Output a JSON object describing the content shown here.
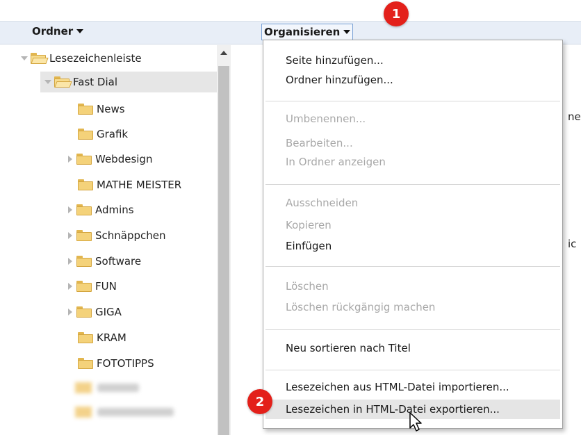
{
  "toolbar": {
    "ordner_label": "Ordner",
    "organize_label": "Organisieren"
  },
  "tree": {
    "root": "Lesezeichenleiste",
    "fast_dial": "Fast Dial",
    "folders": [
      "News",
      "Grafik",
      "Webdesign",
      "MATHE MEISTER",
      "Admins",
      "Schnäppchen",
      "Software",
      "FUN",
      "GIGA",
      "KRAM",
      "FOTOTIPPS"
    ]
  },
  "menu": {
    "add_page": "Seite hinzufügen...",
    "add_folder": "Ordner hinzufügen...",
    "rename": "Umbenennen...",
    "edit": "Bearbeiten...",
    "show_in_folder": "In Ordner anzeigen",
    "cut": "Ausschneiden",
    "copy": "Kopieren",
    "paste": "Einfügen",
    "delete": "Löschen",
    "undo_delete": "Löschen rückgängig machen",
    "sort_by_title": "Neu sortieren nach Titel",
    "import_html": "Lesezeichen aus HTML-Datei importieren...",
    "export_html": "Lesezeichen in HTML-Datei exportieren..."
  },
  "right_clipped": {
    "text1": "ne",
    "text2": "ic"
  },
  "badges": {
    "one": "1",
    "two": "2"
  },
  "colors": {
    "badge_red": "#e3201a",
    "toolbar_bg": "#e8eef7",
    "folder_yellow": "#f4d27a"
  }
}
